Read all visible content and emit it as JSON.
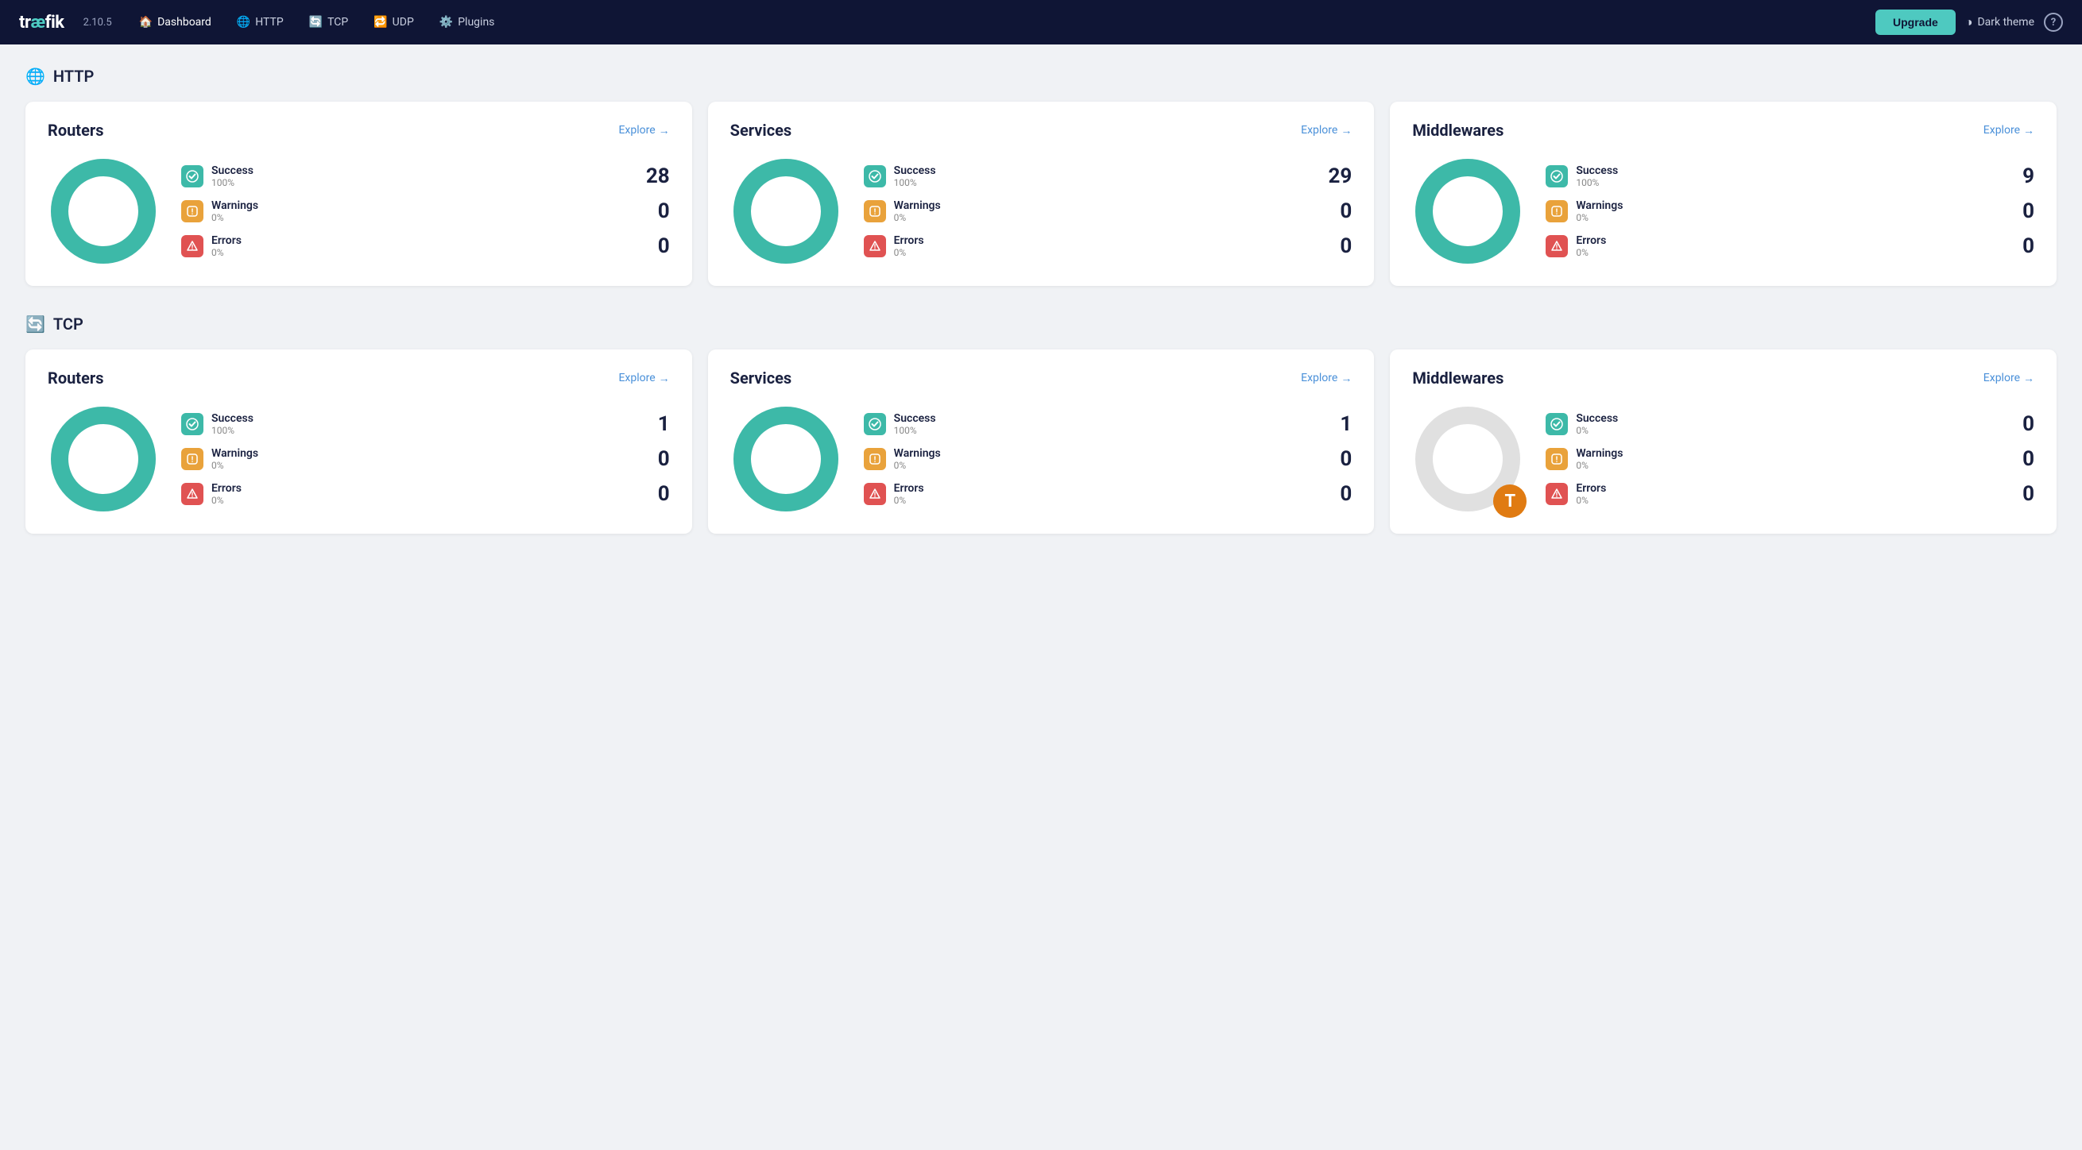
{
  "app": {
    "logo": "træfik",
    "logo_trf": "træ",
    "version": "2.10.5",
    "nav_items": [
      {
        "id": "dashboard",
        "label": "Dashboard",
        "icon": "🏠",
        "active": true
      },
      {
        "id": "http",
        "label": "HTTP",
        "icon": "🌐"
      },
      {
        "id": "tcp",
        "label": "TCP",
        "icon": "🔄"
      },
      {
        "id": "udp",
        "label": "UDP",
        "icon": "🔁"
      },
      {
        "id": "plugins",
        "label": "Plugins",
        "icon": "⚙️"
      }
    ],
    "upgrade_label": "Upgrade",
    "dark_theme_label": "Dark theme",
    "help_icon": "?"
  },
  "sections": [
    {
      "id": "http",
      "title": "HTTP",
      "icon": "🌐",
      "cards": [
        {
          "id": "http-routers",
          "title": "Routers",
          "explore_label": "Explore",
          "success_count": "28",
          "success_pct": "100%",
          "warnings_count": "0",
          "warnings_pct": "0%",
          "errors_count": "0",
          "errors_pct": "0%",
          "donut_success_pct": 100,
          "has_data": true
        },
        {
          "id": "http-services",
          "title": "Services",
          "explore_label": "Explore",
          "success_count": "29",
          "success_pct": "100%",
          "warnings_count": "0",
          "warnings_pct": "0%",
          "errors_count": "0",
          "errors_pct": "0%",
          "donut_success_pct": 100,
          "has_data": true
        },
        {
          "id": "http-middlewares",
          "title": "Middlewares",
          "explore_label": "Explore",
          "success_count": "9",
          "success_pct": "100%",
          "warnings_count": "0",
          "warnings_pct": "0%",
          "errors_count": "0",
          "errors_pct": "0%",
          "donut_success_pct": 100,
          "has_data": true
        }
      ]
    },
    {
      "id": "tcp",
      "title": "TCP",
      "icon": "🔄",
      "cards": [
        {
          "id": "tcp-routers",
          "title": "Routers",
          "explore_label": "Explore",
          "success_count": "1",
          "success_pct": "100%",
          "warnings_count": "0",
          "warnings_pct": "0%",
          "errors_count": "0",
          "errors_pct": "0%",
          "donut_success_pct": 100,
          "has_data": true
        },
        {
          "id": "tcp-services",
          "title": "Services",
          "explore_label": "Explore",
          "success_count": "1",
          "success_pct": "100%",
          "warnings_count": "0",
          "warnings_pct": "0%",
          "errors_count": "0",
          "errors_pct": "0%",
          "donut_success_pct": 100,
          "has_data": true
        },
        {
          "id": "tcp-middlewares",
          "title": "Middlewares",
          "explore_label": "Explore",
          "success_count": "0",
          "success_pct": "0%",
          "warnings_count": "0",
          "warnings_pct": "0%",
          "errors_count": "0",
          "errors_pct": "0%",
          "donut_success_pct": 0,
          "has_data": false
        }
      ]
    }
  ],
  "colors": {
    "success": "#3db9a8",
    "warning": "#e9a23b",
    "error": "#e05252",
    "empty": "#e8e8e8",
    "donut_bg": "#f0f2f5"
  },
  "legend": {
    "success_label": "Success",
    "warnings_label": "Warnings",
    "errors_label": "Errors"
  }
}
